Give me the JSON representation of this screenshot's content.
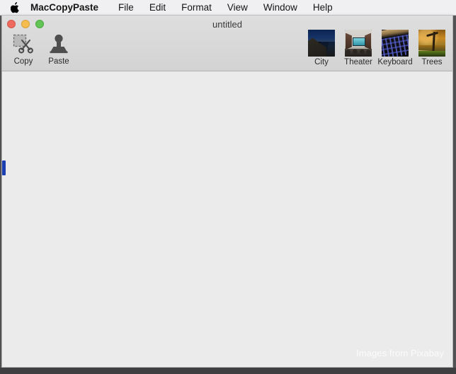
{
  "menubar": {
    "apple_icon": "apple-logo-icon",
    "app_name": "MacCopyPaste",
    "items": [
      "File",
      "Edit",
      "Format",
      "View",
      "Window",
      "Help"
    ]
  },
  "window": {
    "title": "untitled",
    "traffic_lights": {
      "close": "close-button",
      "minimize": "minimize-button",
      "maximize": "maximize-button"
    },
    "colors": {
      "close": "#ee6a5f",
      "minimize": "#f5bd4f",
      "maximize": "#61c454",
      "titlebar": "#d6d6d7",
      "content": "#ebebeb",
      "scroll_thumb": "#1b3fb0"
    }
  },
  "toolbar": {
    "actions": [
      {
        "label": "Copy",
        "icon": "scissors-icon"
      },
      {
        "label": "Paste",
        "icon": "stamp-icon"
      }
    ],
    "thumbnails": [
      {
        "label": "City",
        "icon": "city-thumbnail"
      },
      {
        "label": "Theater",
        "icon": "theater-thumbnail"
      },
      {
        "label": "Keyboard",
        "icon": "keyboard-thumbnail"
      },
      {
        "label": "Trees",
        "icon": "trees-thumbnail"
      }
    ]
  },
  "content": {
    "document_text": "",
    "watermark": "Images from Pixabay"
  }
}
